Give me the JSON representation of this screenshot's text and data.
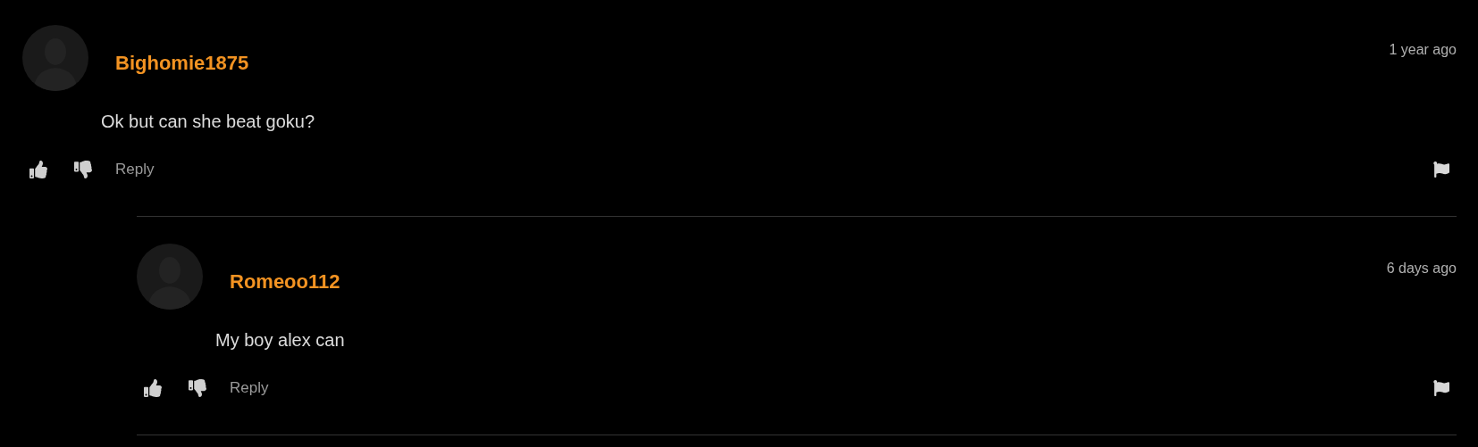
{
  "comments": [
    {
      "username": "Bighomie1875",
      "time": "1 year ago",
      "text": "Ok but can she beat goku?",
      "reply_label": "Reply",
      "children": [
        {
          "username": "Romeoo112",
          "time": "6 days ago",
          "text": "My boy alex can",
          "reply_label": "Reply"
        }
      ]
    }
  ]
}
